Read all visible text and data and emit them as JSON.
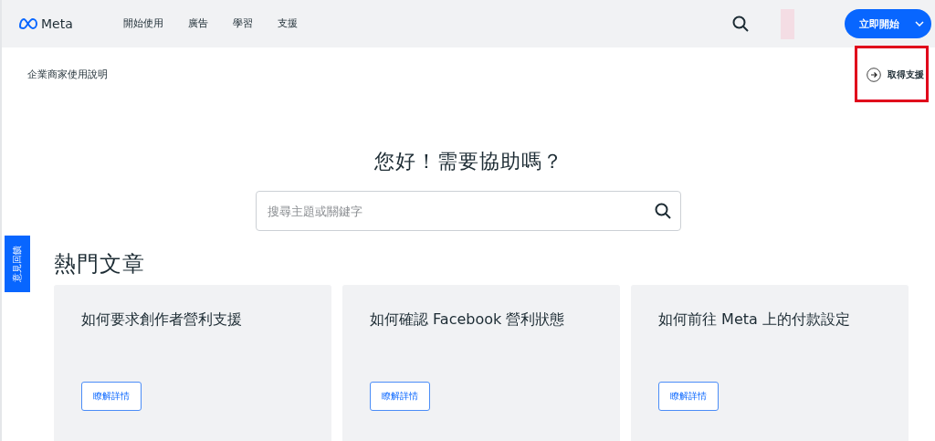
{
  "header": {
    "logo": "Meta",
    "nav": [
      "開始使用",
      "廣告",
      "學習",
      "支援"
    ],
    "cta": "立即開始"
  },
  "subheader": {
    "title": "企業商家使用說明",
    "support_link": {
      "label": "取得支援",
      "highlighted": true
    }
  },
  "hero": {
    "title": "您好！需要協助嗎？",
    "search": {
      "placeholder": "搜尋主題或關鍵字"
    }
  },
  "feedback_tab": "意見回饋",
  "popular": {
    "title": "熱門文章",
    "articles": [
      {
        "title": "如何要求創作者營利支援",
        "button": "瞭解詳情"
      },
      {
        "title": "如何確認 Facebook 營利狀態",
        "button": "瞭解詳情"
      },
      {
        "title": "如何前往 Meta 上的付款設定",
        "button": "瞭解詳情"
      }
    ]
  }
}
